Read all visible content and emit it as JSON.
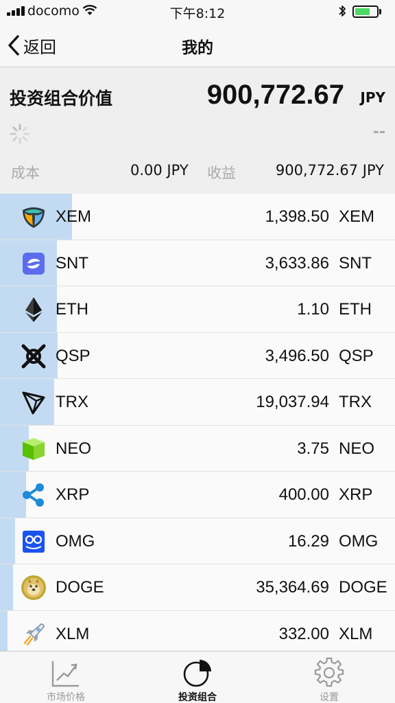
{
  "status_bar": {
    "carrier": "docomo",
    "time": "下午8:12",
    "battery_level": 0.7
  },
  "nav": {
    "back_label": "返回",
    "title": "我的"
  },
  "summary": {
    "label": "投资组合价值",
    "value": "900,772.67",
    "currency": "JPY",
    "change": "--",
    "cost_label": "成本",
    "cost_value": "0.00 JPY",
    "profit_label": "收益",
    "profit_value": "900,772.67 JPY"
  },
  "coins": [
    {
      "symbol": "XEM",
      "amount": "1,398.50",
      "unit": "XEM",
      "share": 0.182,
      "icon": "nem-icon"
    },
    {
      "symbol": "SNT",
      "amount": "3,633.86",
      "unit": "SNT",
      "share": 0.144,
      "icon": "status-icon"
    },
    {
      "symbol": "ETH",
      "amount": "1.10",
      "unit": "ETH",
      "share": 0.144,
      "icon": "ethereum-icon"
    },
    {
      "symbol": "QSP",
      "amount": "3,496.50",
      "unit": "QSP",
      "share": 0.146,
      "icon": "quantstamp-icon"
    },
    {
      "symbol": "TRX",
      "amount": "19,037.94",
      "unit": "TRX",
      "share": 0.137,
      "icon": "tron-icon"
    },
    {
      "symbol": "NEO",
      "amount": "3.75",
      "unit": "NEO",
      "share": 0.073,
      "icon": "neo-icon"
    },
    {
      "symbol": "XRP",
      "amount": "400.00",
      "unit": "XRP",
      "share": 0.066,
      "icon": "ripple-icon"
    },
    {
      "symbol": "OMG",
      "amount": "16.29",
      "unit": "OMG",
      "share": 0.038,
      "icon": "omisego-icon"
    },
    {
      "symbol": "DOGE",
      "amount": "35,364.69",
      "unit": "DOGE",
      "share": 0.033,
      "icon": "dogecoin-icon"
    },
    {
      "symbol": "XLM",
      "amount": "332.00",
      "unit": "XLM",
      "share": 0.019,
      "icon": "stellar-rocket-icon"
    }
  ],
  "tabs": [
    {
      "label": "市场价格",
      "icon": "trend-chart-icon",
      "active": false
    },
    {
      "label": "投资组合",
      "icon": "pie-chart-icon",
      "active": true
    },
    {
      "label": "设置",
      "icon": "gear-icon",
      "active": false
    }
  ],
  "colors": {
    "share_bar": "#c3dbf2",
    "battery": "#4cd964",
    "muted_text": "#aaaaaa"
  }
}
